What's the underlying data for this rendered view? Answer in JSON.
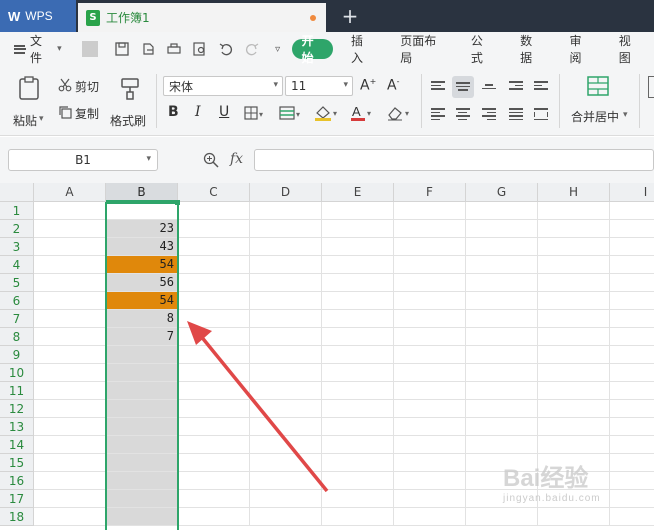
{
  "titlebar": {
    "app_label": "WPS",
    "doc_icon": "S",
    "doc_name": "工作簿1",
    "new_tab": "+"
  },
  "menubar": {
    "file_label": "文件",
    "items": [
      "开始",
      "插入",
      "页面布局",
      "公式",
      "数据",
      "审阅",
      "视图"
    ],
    "active_index": 0
  },
  "ribbon": {
    "paste_label": "粘贴",
    "cut_label": "剪切",
    "copy_label": "复制",
    "format_painter_label": "格式刷",
    "font_name": "宋体",
    "font_size": "11",
    "merge_label": "合并居中"
  },
  "formula_bar": {
    "name_box": "B1",
    "fx_label": "fx",
    "formula": ""
  },
  "sheet": {
    "columns": [
      "A",
      "B",
      "C",
      "D",
      "E",
      "F",
      "G",
      "H",
      "I"
    ],
    "selected_column": "B",
    "rows": [
      "1",
      "2",
      "3",
      "4",
      "5",
      "6",
      "7",
      "8",
      "9",
      "10",
      "11",
      "12",
      "13",
      "14",
      "15",
      "16",
      "17",
      "18"
    ],
    "colB_values": [
      "",
      "23",
      "43",
      "54",
      "56",
      "54",
      "8",
      "7",
      "",
      "",
      "",
      "",
      "",
      "",
      "",
      "",
      "",
      ""
    ],
    "highlighted_rows": [
      4,
      6
    ],
    "highlight_color": "#e0880b",
    "selection_color": "#2ea56a",
    "arrow_color": "#e04848"
  },
  "watermark": {
    "brand": "Bai经验",
    "url": "jingyan.baidu.com"
  }
}
